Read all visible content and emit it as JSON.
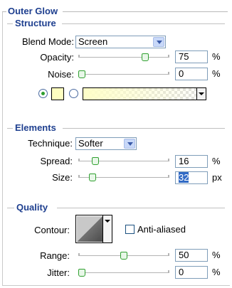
{
  "outer_glow": {
    "title": "Outer Glow",
    "structure": {
      "title": "Structure",
      "blend_mode": {
        "label": "Blend Mode:",
        "value": "Screen"
      },
      "opacity": {
        "label": "Opacity:",
        "value": "75",
        "unit": "%",
        "level": 0.75
      },
      "noise": {
        "label": "Noise:",
        "value": "0",
        "unit": "%",
        "level": 0.0
      },
      "color_swatch": "#ffffc0",
      "gradient_color": "#ffffc8",
      "color_selected": true
    },
    "elements": {
      "title": "Elements",
      "technique": {
        "label": "Technique:",
        "value": "Softer"
      },
      "spread": {
        "label": "Spread:",
        "value": "16",
        "unit": "%",
        "level": 0.16
      },
      "size": {
        "label": "Size:",
        "value": "32",
        "unit": "px",
        "level": 0.13
      }
    },
    "quality": {
      "title": "Quality",
      "contour": {
        "label": "Contour:"
      },
      "anti_aliased": {
        "label": "Anti-aliased",
        "checked": false
      },
      "range": {
        "label": "Range:",
        "value": "50",
        "unit": "%",
        "level": 0.5
      },
      "jitter": {
        "label": "Jitter:",
        "value": "0",
        "unit": "%",
        "level": 0.0
      }
    }
  }
}
